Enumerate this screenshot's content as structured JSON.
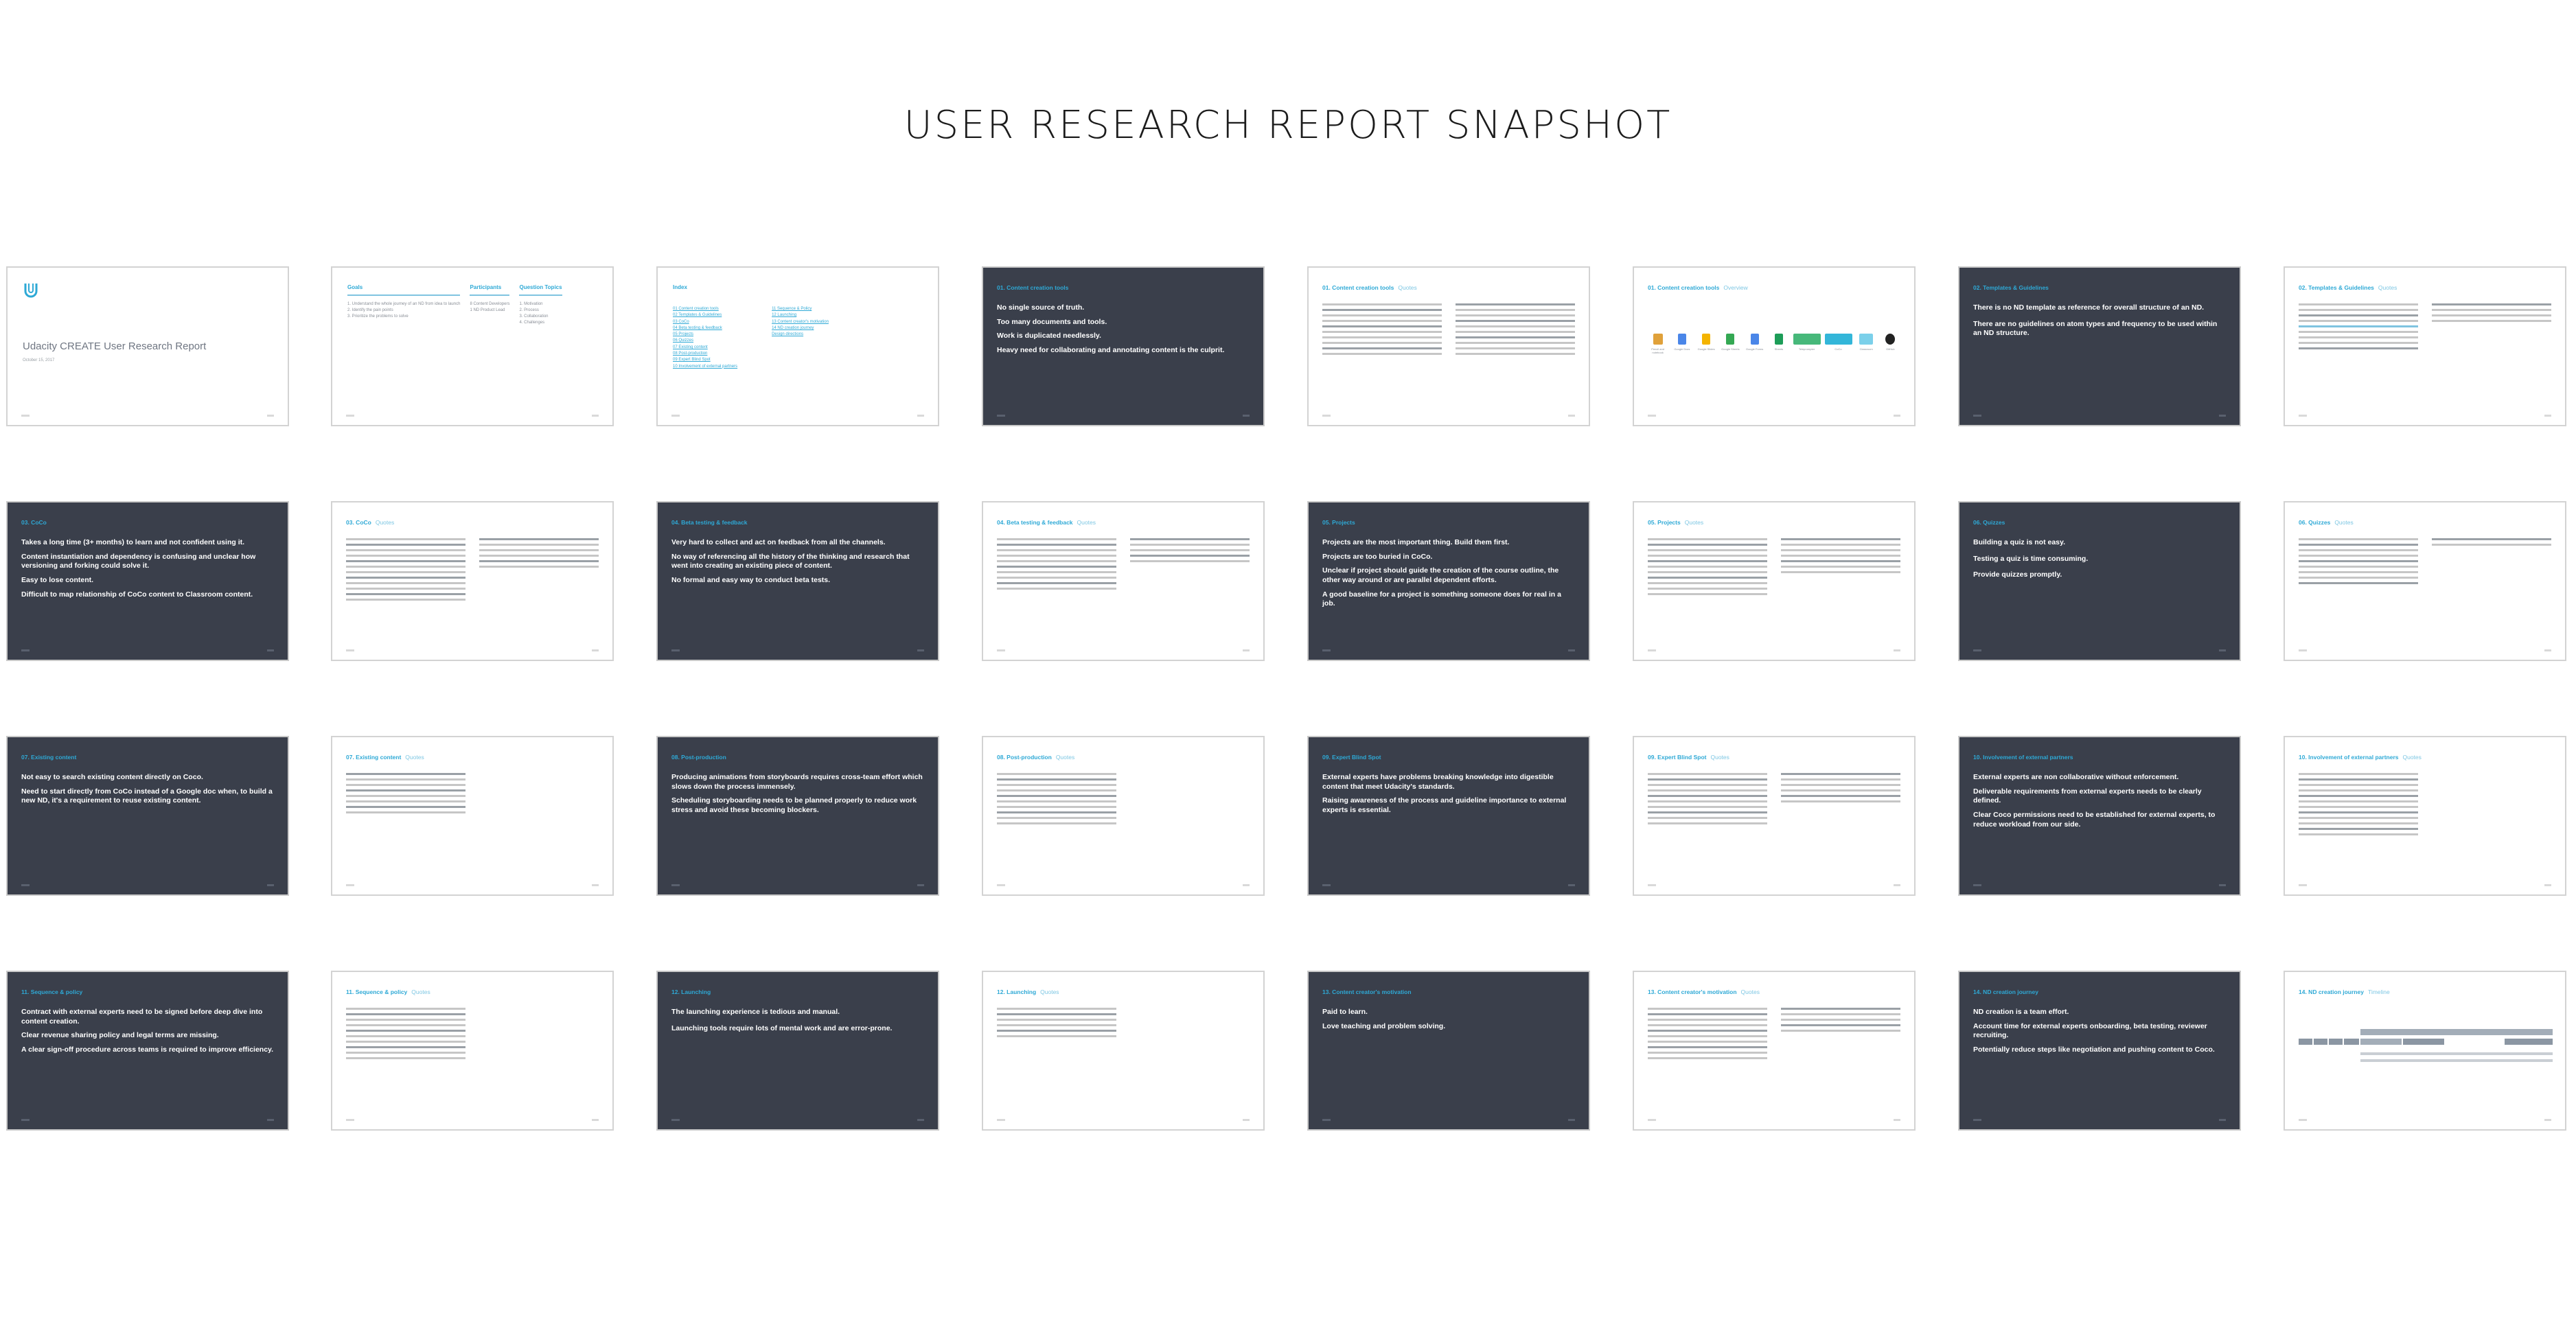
{
  "report": {
    "title": "USER RESEARCH REPORT SNAPSHOT"
  },
  "cover": {
    "title": "Udacity CREATE User Research Report",
    "date": "October 15, 2017"
  },
  "overview": {
    "columns": [
      {
        "heading": "Goals",
        "items": [
          "1. Understand the whole journey of an ND from idea to launch",
          "2. Identify the pain points",
          "3. Prioritize the problems to solve"
        ]
      },
      {
        "heading": "Participants",
        "items": [
          "8 Content Developers",
          "1 ND Product Lead"
        ]
      },
      {
        "heading": "Question Topics",
        "items": [
          "1. Motivation",
          "2. Process",
          "3. Collaboration",
          "4. Challenges"
        ]
      }
    ]
  },
  "index": {
    "heading": "Index",
    "left": [
      "01 Content creation tools",
      "02 Templates & Guidelines",
      "03 CoCo",
      "04 Beta testing & feedback",
      "05 Projects",
      "06 Quizzes",
      "07 Existing content",
      "08 Post-production",
      "09 Expert Blind Spot",
      "10 Involvement of external partners"
    ],
    "right": [
      "11 Sequence & Policy",
      "12 Launching",
      "13 Content creator's motivation",
      "14 ND creation journey",
      "",
      "Design directions"
    ]
  },
  "slides": [
    {
      "label": "01. Content creation tools",
      "headlines": [
        "No single source of truth.",
        "Too many documents and tools.",
        "Work is duplicated needlessly.",
        "Heavy need for collaborating and annotating content is the culprit."
      ]
    },
    {
      "label": "02. Templates & Guidelines",
      "headlines": [
        "There is no ND template as reference for overall structure of an ND.",
        "There are no guidelines on atom types and frequency to be used within an ND structure."
      ]
    },
    {
      "label": "03. CoCo",
      "headlines": [
        "Takes a long time (3+ months) to learn and not confident using it.",
        "Content instantiation and dependency is confusing and unclear how versioning and forking could solve it.",
        "Easy to lose content.",
        "Difficult to map relationship of CoCo content to Classroom content."
      ]
    },
    {
      "label": "04. Beta testing & feedback",
      "headlines": [
        "Very hard to collect and act on feedback from all the channels.",
        "No way of referencing all the history of the thinking and research that went into creating an existing piece of content.",
        "No formal and easy way to conduct beta tests."
      ]
    },
    {
      "label": "05. Projects",
      "headlines": [
        "Projects are the most important thing. Build them first.",
        "Projects are too buried in CoCo.",
        "Unclear if project should guide the creation of the course outline, the other way around or are parallel dependent efforts.",
        "A good baseline for a project is something someone does for real in a job."
      ]
    },
    {
      "label": "06. Quizzes",
      "headlines": [
        "Building a quiz is not easy.",
        "Testing a quiz is time consuming.",
        "Provide quizzes promptly."
      ]
    },
    {
      "label": "07. Existing content",
      "headlines": [
        "Not easy to search existing content directly on Coco.",
        "Need to start directly from CoCo instead of a Google doc when, to build a new ND, it's a requirement to reuse existing content."
      ]
    },
    {
      "label": "08. Post-production",
      "headlines": [
        "Producing animations from storyboards requires cross-team effort which slows down the process immensely.",
        "Scheduling storyboarding needs to be planned properly to reduce work stress and avoid these becoming blockers."
      ]
    },
    {
      "label": "09. Expert Blind Spot",
      "headlines": [
        "External experts have problems breaking knowledge into digestible content that meet Udacity's standards.",
        "Raising awareness of the process and guideline importance to external experts is essential."
      ]
    },
    {
      "label": "10. Involvement of external partners",
      "headlines": [
        "External experts are non collaborative without enforcement.",
        "Deliverable requirements from external experts needs to be clearly defined.",
        "Clear Coco permissions need to be established for external experts, to reduce workload from our side."
      ]
    },
    {
      "label": "11. Sequence & policy",
      "headlines": [
        "Contract with external experts need to be signed before deep dive into content creation.",
        "Clear revenue sharing policy and legal terms are missing.",
        "A clear sign-off procedure across teams is required to improve efficiency."
      ]
    },
    {
      "label": "12. Launching",
      "headlines": [
        "The launching experience is tedious and manual.",
        "Launching tools require lots of mental work and are error-prone."
      ]
    },
    {
      "label": "13. Content creator's motivation",
      "headlines": [
        "Paid to learn.",
        "Love teaching and problem solving."
      ]
    },
    {
      "label": "14. ND creation journey",
      "headlines": [
        "ND creation is a team effort.",
        "Account time for external experts onboarding, beta testing, reviewer recruiting.",
        "Potentially reduce steps like negotiation and pushing content to Coco."
      ]
    }
  ],
  "quotes_label": "Quotes",
  "detail_labels": {
    "tools1": "01. Content creation tools",
    "tools2": "01. Content creation tools",
    "templates": "02. Templates & Guidelines",
    "coco": "03. CoCo",
    "beta": "04. Beta testing & feedback",
    "projects": "05. Projects",
    "quizzes": "06. Quizzes",
    "existing": "07. Existing content",
    "post": "08. Post-production",
    "expert": "09. Expert Blind Spot",
    "external": "10. Involvement of external partners",
    "sequence": "11. Sequence & policy",
    "launching": "12. Launching",
    "motivation": "13. Content creator's motivation",
    "journey": "14. ND creation journey"
  },
  "journey_sub": "Timeline",
  "tools_sub": "Overview",
  "tool_icons": [
    {
      "name": "Pencil and notebook",
      "color": "#e0a13a"
    },
    {
      "name": "Google Docs",
      "color": "#4a86e8"
    },
    {
      "name": "Google Slides",
      "color": "#f4b400"
    },
    {
      "name": "Google Sheets",
      "color": "#34a853"
    },
    {
      "name": "Google Forms",
      "color": "#4a86e8"
    },
    {
      "name": "Sheets",
      "color": "#1d9d58"
    },
    {
      "name": "Teleprompter",
      "color": "#47b87a"
    },
    {
      "name": "CoCo",
      "color": "#33b6d9"
    },
    {
      "name": "Classroom",
      "color": "#7bd0ea"
    },
    {
      "name": "GitHub",
      "color": "#222222"
    }
  ],
  "colors": {
    "dark_slide": "#3a3f4b",
    "accent": "#2ea9d6",
    "border": "#d3d3d3"
  }
}
